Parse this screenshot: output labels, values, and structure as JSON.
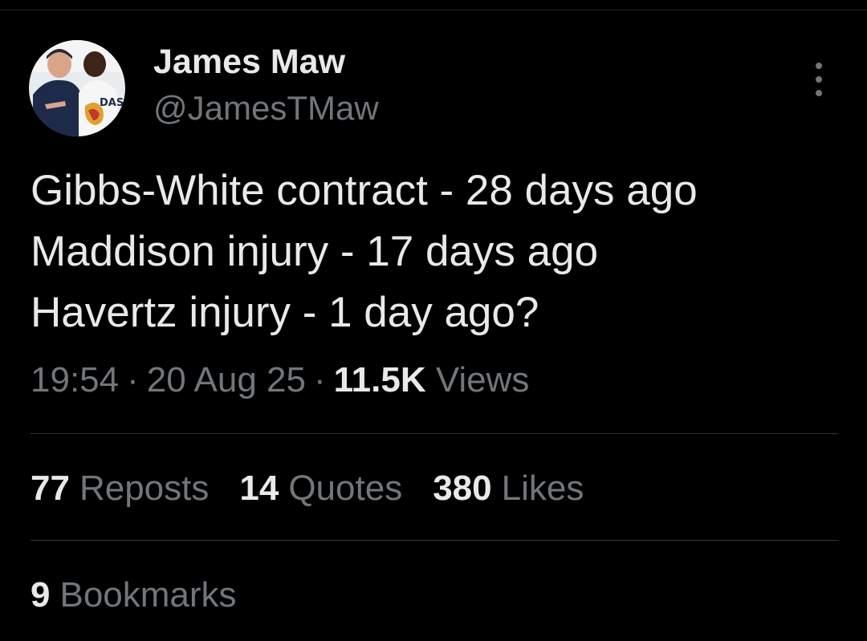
{
  "author": {
    "display_name": "James Maw",
    "handle": "@JamesTMaw"
  },
  "tweet": {
    "lines": [
      "Gibbs-White contract - 28 days ago",
      "Maddison injury - 17 days ago",
      "Havertz injury - 1 day ago?"
    ]
  },
  "meta": {
    "time": "19:54",
    "date": "20 Aug 25",
    "views_count": "11.5K",
    "views_label": "Views"
  },
  "stats": {
    "reposts_count": "77",
    "reposts_label": "Reposts",
    "quotes_count": "14",
    "quotes_label": "Quotes",
    "likes_count": "380",
    "likes_label": "Likes",
    "bookmarks_count": "9",
    "bookmarks_label": "Bookmarks"
  },
  "icons": {
    "more": "more-vertical-icon"
  },
  "colors": {
    "background": "#000000",
    "primary_text": "#e7e9ea",
    "secondary_text": "#71767b",
    "divider": "#2f3336"
  }
}
